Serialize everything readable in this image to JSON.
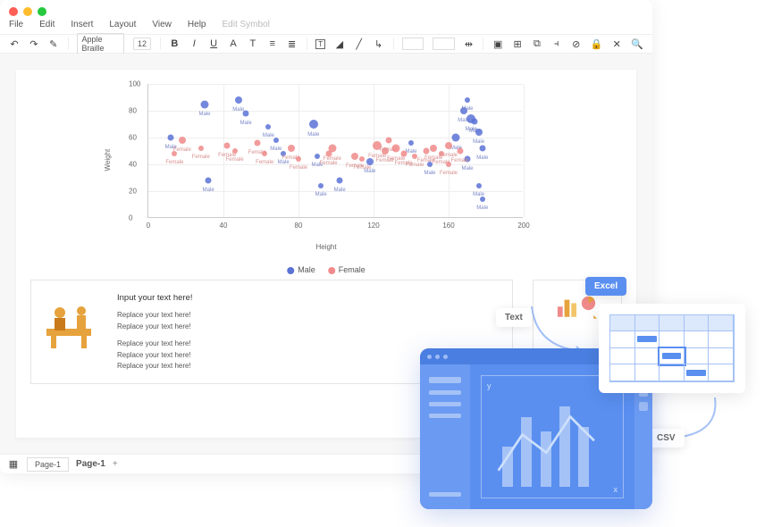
{
  "menubar": [
    "File",
    "Edit",
    "Insert",
    "Layout",
    "View",
    "Help",
    "Edit Symbol"
  ],
  "toolbar": {
    "font": "Apple Braille",
    "size": "12"
  },
  "page_tab": "Page-1",
  "page_label": "Page-1",
  "card1": {
    "title": "Input your text here!",
    "lines": [
      "Replace your text here!",
      "Replace your text here!",
      "Replace your text here!",
      "Replace your text here!",
      "Replace your text here!"
    ]
  },
  "overlay": {
    "excel": "Excel",
    "text": "Text",
    "csv": "CSV"
  },
  "chart_data": {
    "type": "scatter",
    "title": "",
    "xlabel": "Height",
    "ylabel": "Weight",
    "xlim": [
      0,
      200
    ],
    "ylim": [
      0,
      100
    ],
    "xticks": [
      0,
      40,
      80,
      120,
      160,
      200
    ],
    "yticks": [
      0,
      20,
      40,
      60,
      80,
      100
    ],
    "legend": [
      "Male",
      "Female"
    ],
    "colors": {
      "Male": "#5a72d6",
      "Female": "#f08a8a"
    },
    "series": [
      {
        "name": "Male",
        "points": [
          {
            "x": 12,
            "y": 60,
            "s": 7
          },
          {
            "x": 30,
            "y": 85,
            "s": 9
          },
          {
            "x": 32,
            "y": 28,
            "s": 7
          },
          {
            "x": 48,
            "y": 88,
            "s": 8
          },
          {
            "x": 52,
            "y": 78,
            "s": 7
          },
          {
            "x": 64,
            "y": 68,
            "s": 6
          },
          {
            "x": 68,
            "y": 58,
            "s": 6
          },
          {
            "x": 72,
            "y": 48,
            "s": 6
          },
          {
            "x": 88,
            "y": 70,
            "s": 10
          },
          {
            "x": 90,
            "y": 46,
            "s": 6
          },
          {
            "x": 92,
            "y": 24,
            "s": 6
          },
          {
            "x": 102,
            "y": 28,
            "s": 7
          },
          {
            "x": 118,
            "y": 42,
            "s": 8
          },
          {
            "x": 140,
            "y": 56,
            "s": 6
          },
          {
            "x": 150,
            "y": 40,
            "s": 6
          },
          {
            "x": 164,
            "y": 60,
            "s": 9
          },
          {
            "x": 168,
            "y": 80,
            "s": 8
          },
          {
            "x": 170,
            "y": 88,
            "s": 6
          },
          {
            "x": 170,
            "y": 44,
            "s": 7
          },
          {
            "x": 172,
            "y": 74,
            "s": 10
          },
          {
            "x": 174,
            "y": 72,
            "s": 7
          },
          {
            "x": 176,
            "y": 64,
            "s": 8
          },
          {
            "x": 176,
            "y": 24,
            "s": 6
          },
          {
            "x": 178,
            "y": 14,
            "s": 6
          },
          {
            "x": 178,
            "y": 52,
            "s": 7
          }
        ]
      },
      {
        "name": "Female",
        "points": [
          {
            "x": 14,
            "y": 48,
            "s": 6
          },
          {
            "x": 18,
            "y": 58,
            "s": 8
          },
          {
            "x": 28,
            "y": 52,
            "s": 6
          },
          {
            "x": 42,
            "y": 54,
            "s": 7
          },
          {
            "x": 46,
            "y": 50,
            "s": 6
          },
          {
            "x": 58,
            "y": 56,
            "s": 7
          },
          {
            "x": 62,
            "y": 48,
            "s": 6
          },
          {
            "x": 76,
            "y": 52,
            "s": 8
          },
          {
            "x": 80,
            "y": 44,
            "s": 6
          },
          {
            "x": 96,
            "y": 48,
            "s": 7
          },
          {
            "x": 98,
            "y": 52,
            "s": 9
          },
          {
            "x": 110,
            "y": 46,
            "s": 8
          },
          {
            "x": 114,
            "y": 44,
            "s": 6
          },
          {
            "x": 122,
            "y": 54,
            "s": 10
          },
          {
            "x": 126,
            "y": 50,
            "s": 8
          },
          {
            "x": 128,
            "y": 58,
            "s": 7
          },
          {
            "x": 132,
            "y": 52,
            "s": 9
          },
          {
            "x": 136,
            "y": 48,
            "s": 7
          },
          {
            "x": 142,
            "y": 46,
            "s": 6
          },
          {
            "x": 148,
            "y": 50,
            "s": 7
          },
          {
            "x": 152,
            "y": 52,
            "s": 8
          },
          {
            "x": 156,
            "y": 48,
            "s": 6
          },
          {
            "x": 160,
            "y": 54,
            "s": 8
          },
          {
            "x": 160,
            "y": 40,
            "s": 6
          },
          {
            "x": 166,
            "y": 50,
            "s": 7
          }
        ]
      }
    ]
  }
}
